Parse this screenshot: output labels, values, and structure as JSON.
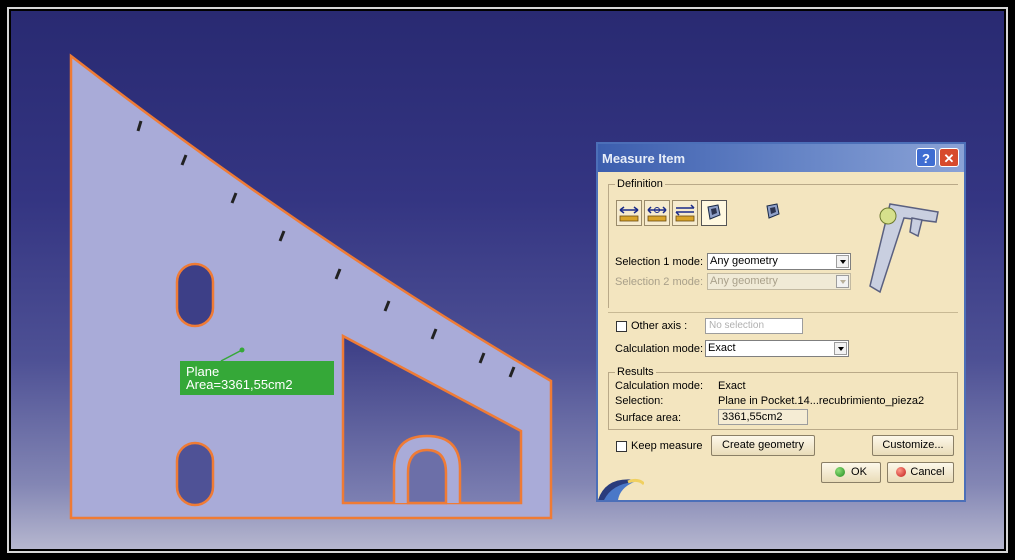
{
  "dialog": {
    "title": "Measure Item",
    "help_label": "?",
    "close_label": "✕",
    "definition_label": "Definition",
    "selection1": {
      "label": "Selection 1 mode:",
      "value": "Any geometry"
    },
    "selection2": {
      "label": "Selection 2 mode:",
      "value": "Any geometry"
    },
    "other_axis": {
      "label": "Other axis :",
      "placeholder": "No selection",
      "checked": false
    },
    "calc_mode": {
      "label": "Calculation mode:",
      "value": "Exact"
    },
    "results": {
      "label": "Results",
      "rows": [
        {
          "key": "Calculation mode:",
          "value": "Exact"
        },
        {
          "key": "Selection:",
          "value": "Plane in Pocket.14...recubrimiento_pieza2"
        },
        {
          "key": "Surface area:",
          "value": "3361,55cm2"
        }
      ]
    },
    "keep_measure": {
      "label": "Keep measure",
      "checked": false
    },
    "create_geometry_label": "Create geometry",
    "customize_label": "Customize...",
    "ok_label": "OK",
    "cancel_label": "Cancel",
    "mode_icons": [
      "measure-between-icon",
      "measure-between-chain-icon",
      "measure-between-fan-icon",
      "measure-item-icon",
      "measure-thickness-icon"
    ]
  },
  "viewport": {
    "annotation": {
      "line1": "Plane",
      "line2": "Area=3361,55cm2"
    }
  },
  "colors": {
    "part_fill": "#a9abd8",
    "part_edge": "#ef7b35",
    "label_bg": "#35a838",
    "dialog_bg": "#f3e5bf",
    "titlebar": "#3c5eae"
  }
}
